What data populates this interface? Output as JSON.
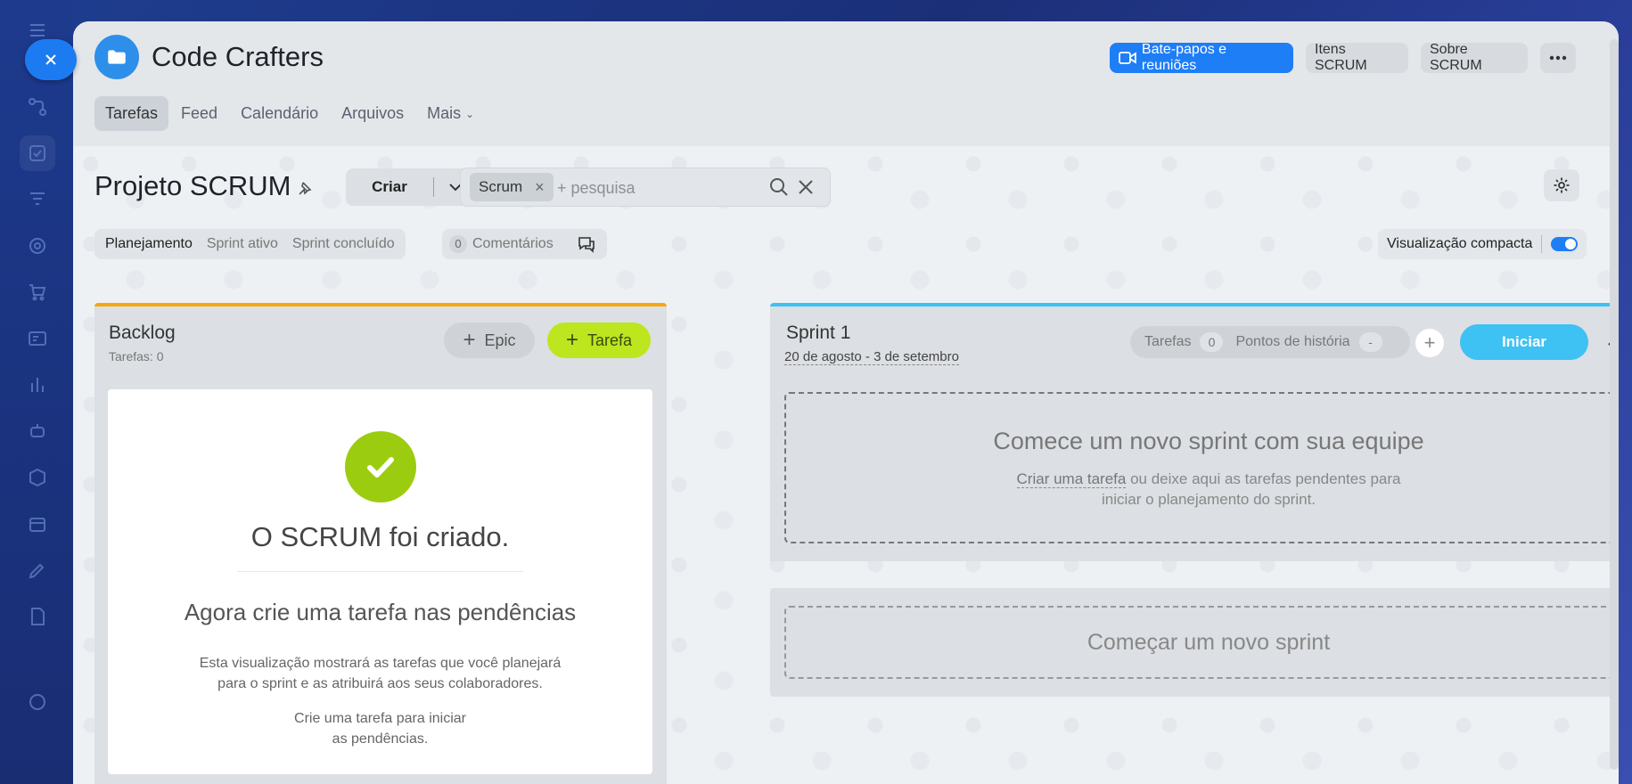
{
  "header": {
    "project_name": "Code Crafters",
    "buttons": {
      "chats": "Bate-papos e reuniões",
      "scrum_items": "Itens SCRUM",
      "about_scrum": "Sobre SCRUM"
    },
    "tabs": [
      {
        "label": "Tarefas",
        "active": true
      },
      {
        "label": "Feed"
      },
      {
        "label": "Calendário"
      },
      {
        "label": "Arquivos"
      },
      {
        "label": "Mais"
      }
    ]
  },
  "toolbar": {
    "page_title": "Projeto SCRUM",
    "create_label": "Criar",
    "filter_chip": "Scrum",
    "search_placeholder": "+ pesquisa"
  },
  "view_tabs": {
    "planning": "Planejamento",
    "active_sprint": "Sprint ativo",
    "completed_sprint": "Sprint concluído",
    "comments_count": "0",
    "comments_label": "Comentários",
    "compact_view": "Visualização compacta",
    "compact_enabled": true
  },
  "backlog": {
    "title": "Backlog",
    "task_count": "Tarefas: 0",
    "epic_button": "Epic",
    "task_button": "Tarefa",
    "empty_state": {
      "title": "O SCRUM foi criado.",
      "subtitle": "Agora crie uma tarefa nas pendências",
      "text1_line1": "Esta visualização mostrará as tarefas que você planejará",
      "text1_line2": "para o sprint e as atribuirá aos seus colaboradores.",
      "text2_line1": "Crie uma tarefa para iniciar",
      "text2_line2": "as pendências."
    }
  },
  "sprint": {
    "title": "Sprint 1",
    "dates": "20 de agosto - 3 de setembro",
    "tasks_label": "Tarefas",
    "tasks_count": "0",
    "story_points_label": "Pontos de história",
    "story_points_value": "-",
    "start_button": "Iniciar",
    "drop_title": "Comece um novo sprint com sua equipe",
    "drop_link": "Criar uma tarefa",
    "drop_text_rest": " ou deixe aqui as tarefas pendentes para",
    "drop_text_line2": "iniciar o planejamento do sprint."
  },
  "new_sprint": {
    "label": "Começar um novo sprint"
  },
  "colors": {
    "accent_blue": "#1e7ef6",
    "backlog_border": "#f5a70f",
    "sprint_border": "#3ec1f3",
    "task_button": "#bde61f",
    "check_green": "#9ccc0f"
  }
}
